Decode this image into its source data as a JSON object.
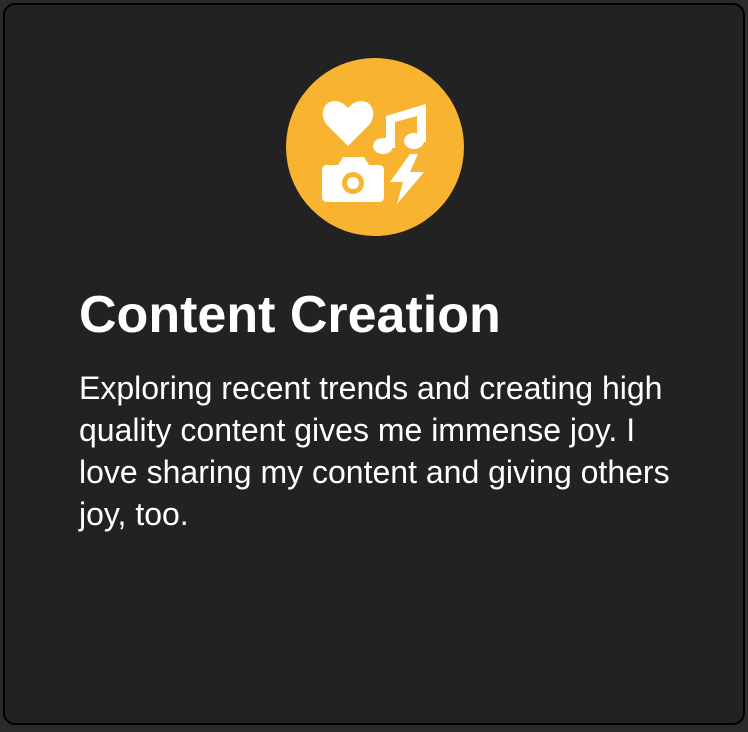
{
  "card": {
    "icon": "content-creation-icons",
    "accent_color": "#f8b431",
    "background_color": "#222222",
    "title": "Content Creation",
    "description": "Exploring recent trends and creating high quality content gives me immense joy. I love sharing my content and giving others joy, too."
  }
}
